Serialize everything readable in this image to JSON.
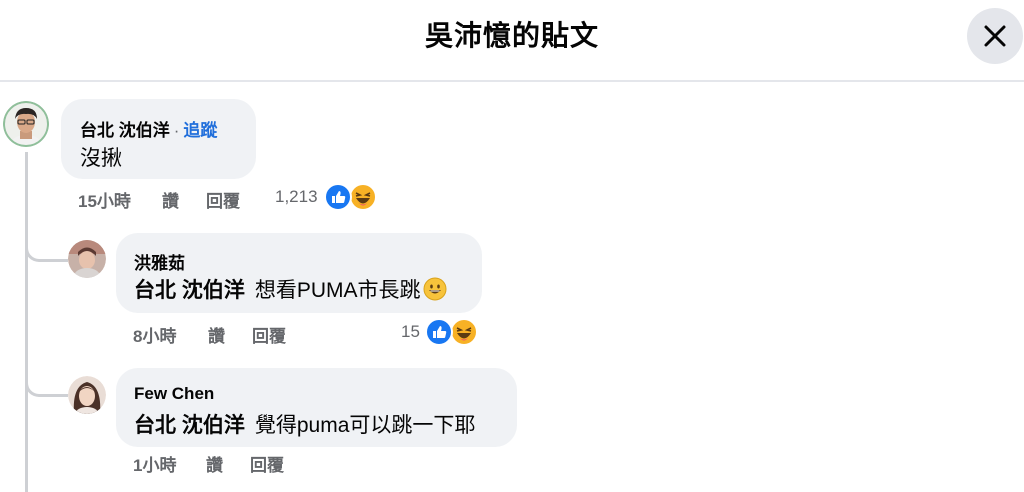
{
  "header": {
    "title": "吳沛憶的貼文"
  },
  "comments": [
    {
      "author": "台北 沈伯洋",
      "follow": "追蹤",
      "text": "沒揪",
      "time": "15小時",
      "like": "讚",
      "reply": "回覆",
      "reactions": "1,213"
    },
    {
      "author": "洪雅茹",
      "mention": "台北 沈伯洋",
      "text": "想看PUMA市長跳",
      "time": "8小時",
      "like": "讚",
      "reply": "回覆",
      "reactions": "15"
    },
    {
      "author": "Few Chen",
      "mention": "台北 沈伯洋",
      "text": "覺得puma可以跳一下耶",
      "time": "1小時",
      "like": "讚",
      "reply": "回覆"
    }
  ],
  "colors": {
    "like_blue": "#1877f2",
    "haha_yellow": "#f7b125",
    "link_blue": "#216fdb"
  },
  "icons": [
    "close-icon",
    "like-reaction-icon",
    "haha-reaction-icon",
    "smile-emoji-icon"
  ]
}
